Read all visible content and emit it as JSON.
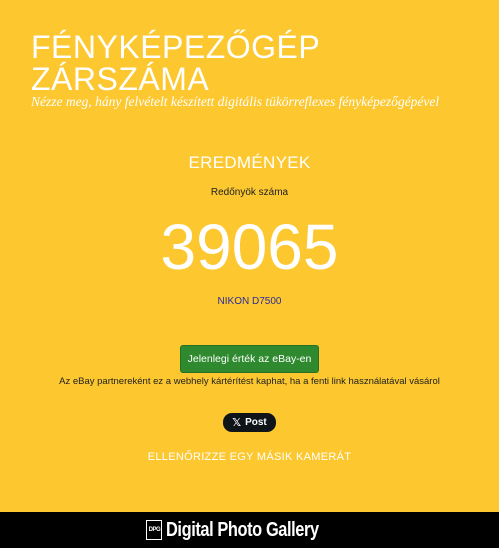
{
  "header": {
    "title_line1": "FÉNYKÉPEZŐGÉP",
    "title_line2": "ZÁRSZÁMA",
    "subtitle": "Nézze meg, hány felvételt készített digitális tükörreflexes fényképezőgépével"
  },
  "results": {
    "heading": "EREDMÉNYEK",
    "count_label": "Redőnyök száma",
    "count_value": "39065",
    "camera_model": "NIKON D7500"
  },
  "actions": {
    "ebay_button": "Jelenlegi érték az eBay-en",
    "affiliate_note": "Az eBay partnereként ez a webhely kártérítést kaphat, ha a fenti link használatával vásárol",
    "post_button": "Post",
    "post_icon": "𝕏",
    "check_other": "ELLENŐRIZZE EGY MÁSIK KAMERÁT"
  },
  "footer": {
    "logo_mark": "DPG",
    "logo_text": "Digital Photo Gallery"
  },
  "colors": {
    "background": "#fcc72f",
    "ebay_button": "#2f8a2f",
    "link": "#2b2b9a",
    "footer": "#000000"
  }
}
